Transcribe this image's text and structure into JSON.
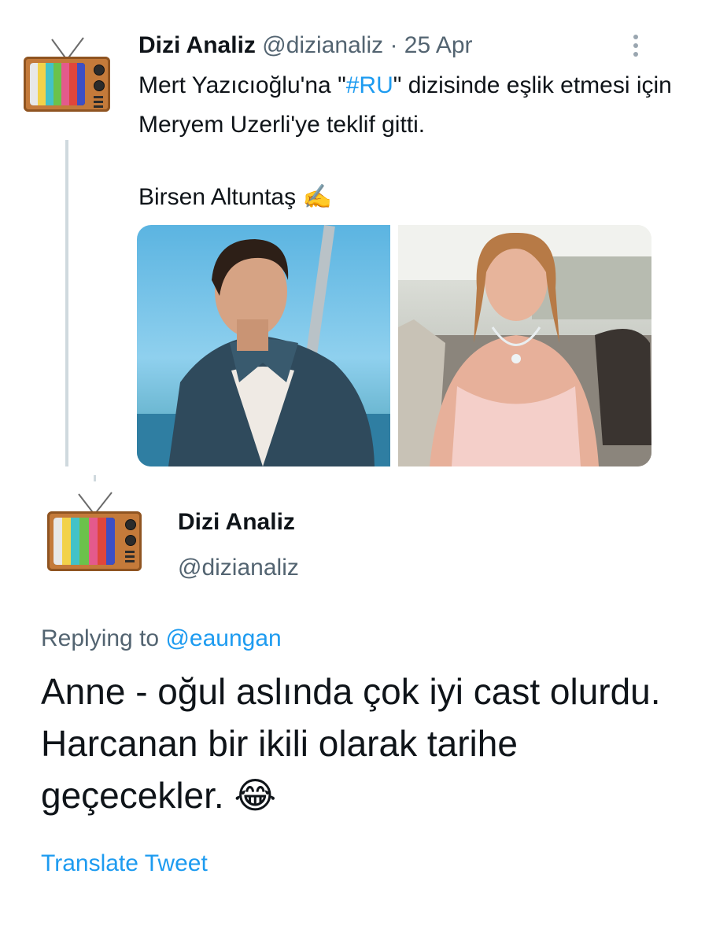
{
  "tweet1": {
    "display_name": "Dizi Analiz",
    "handle": "@dizianaliz",
    "separator": "·",
    "date": "25 Apr",
    "text_part1": "Mert Yazıcıoğlu'na \"",
    "hashtag": "#RU",
    "text_part2": "\" dizisinde eşlik etmesi için Meryem Uzerli'ye teklif gitti.",
    "author_line": "Birsen Altuntaş",
    "author_emoji": "✍️",
    "media": [
      {
        "description_icon": "man-portrait-photo"
      },
      {
        "description_icon": "woman-portrait-photo"
      }
    ]
  },
  "tweet2": {
    "display_name": "Dizi Analiz",
    "handle": "@dizianaliz",
    "replying_prefix": "Replying to",
    "replying_to": "@eaungan",
    "text": "Anne - oğul aslında çok iyi cast olurdu. Harcanan bir ikili olarak tarihe geçecekler.",
    "emoji": "😂",
    "translate_label": "Translate Tweet"
  },
  "colors": {
    "accent": "#1d9bf0",
    "secondary_text": "#536471",
    "primary_text": "#0f1419",
    "thread_line": "#cfd9de"
  }
}
